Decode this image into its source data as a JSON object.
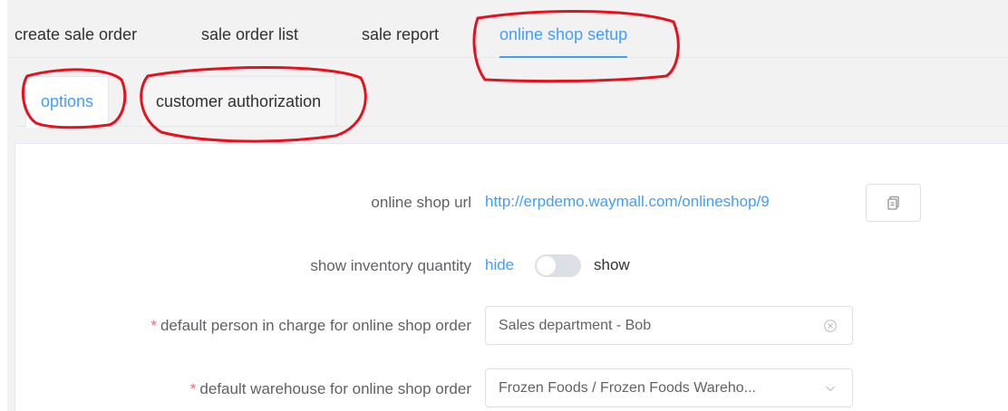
{
  "top_tabs": [
    {
      "label": "create sale order"
    },
    {
      "label": "sale order list"
    },
    {
      "label": "sale report"
    },
    {
      "label": "online shop setup"
    }
  ],
  "sub_tabs": [
    {
      "label": "options"
    },
    {
      "label": "customer authorization"
    }
  ],
  "form": {
    "shop_url_label": "online shop url",
    "shop_url_value": "http://erpdemo.waymall.com/onlineshop/9",
    "inventory_label": "show inventory quantity",
    "inventory_hide": "hide",
    "inventory_show": "show",
    "inventory_enabled": false,
    "person_required_mark": "*",
    "person_label": "default person in charge for online shop order",
    "person_value": "Sales department - Bob",
    "warehouse_required_mark": "*",
    "warehouse_label": "default warehouse for online shop order",
    "warehouse_value": "Frozen Foods / Frozen Foods Wareho..."
  },
  "colors": {
    "accent": "#409eff",
    "required": "#f56c6c",
    "annotation": "#e8101a"
  },
  "icons": {
    "copy": "copy-icon",
    "clear": "circle-close-icon",
    "dropdown": "chevron-down-icon"
  }
}
